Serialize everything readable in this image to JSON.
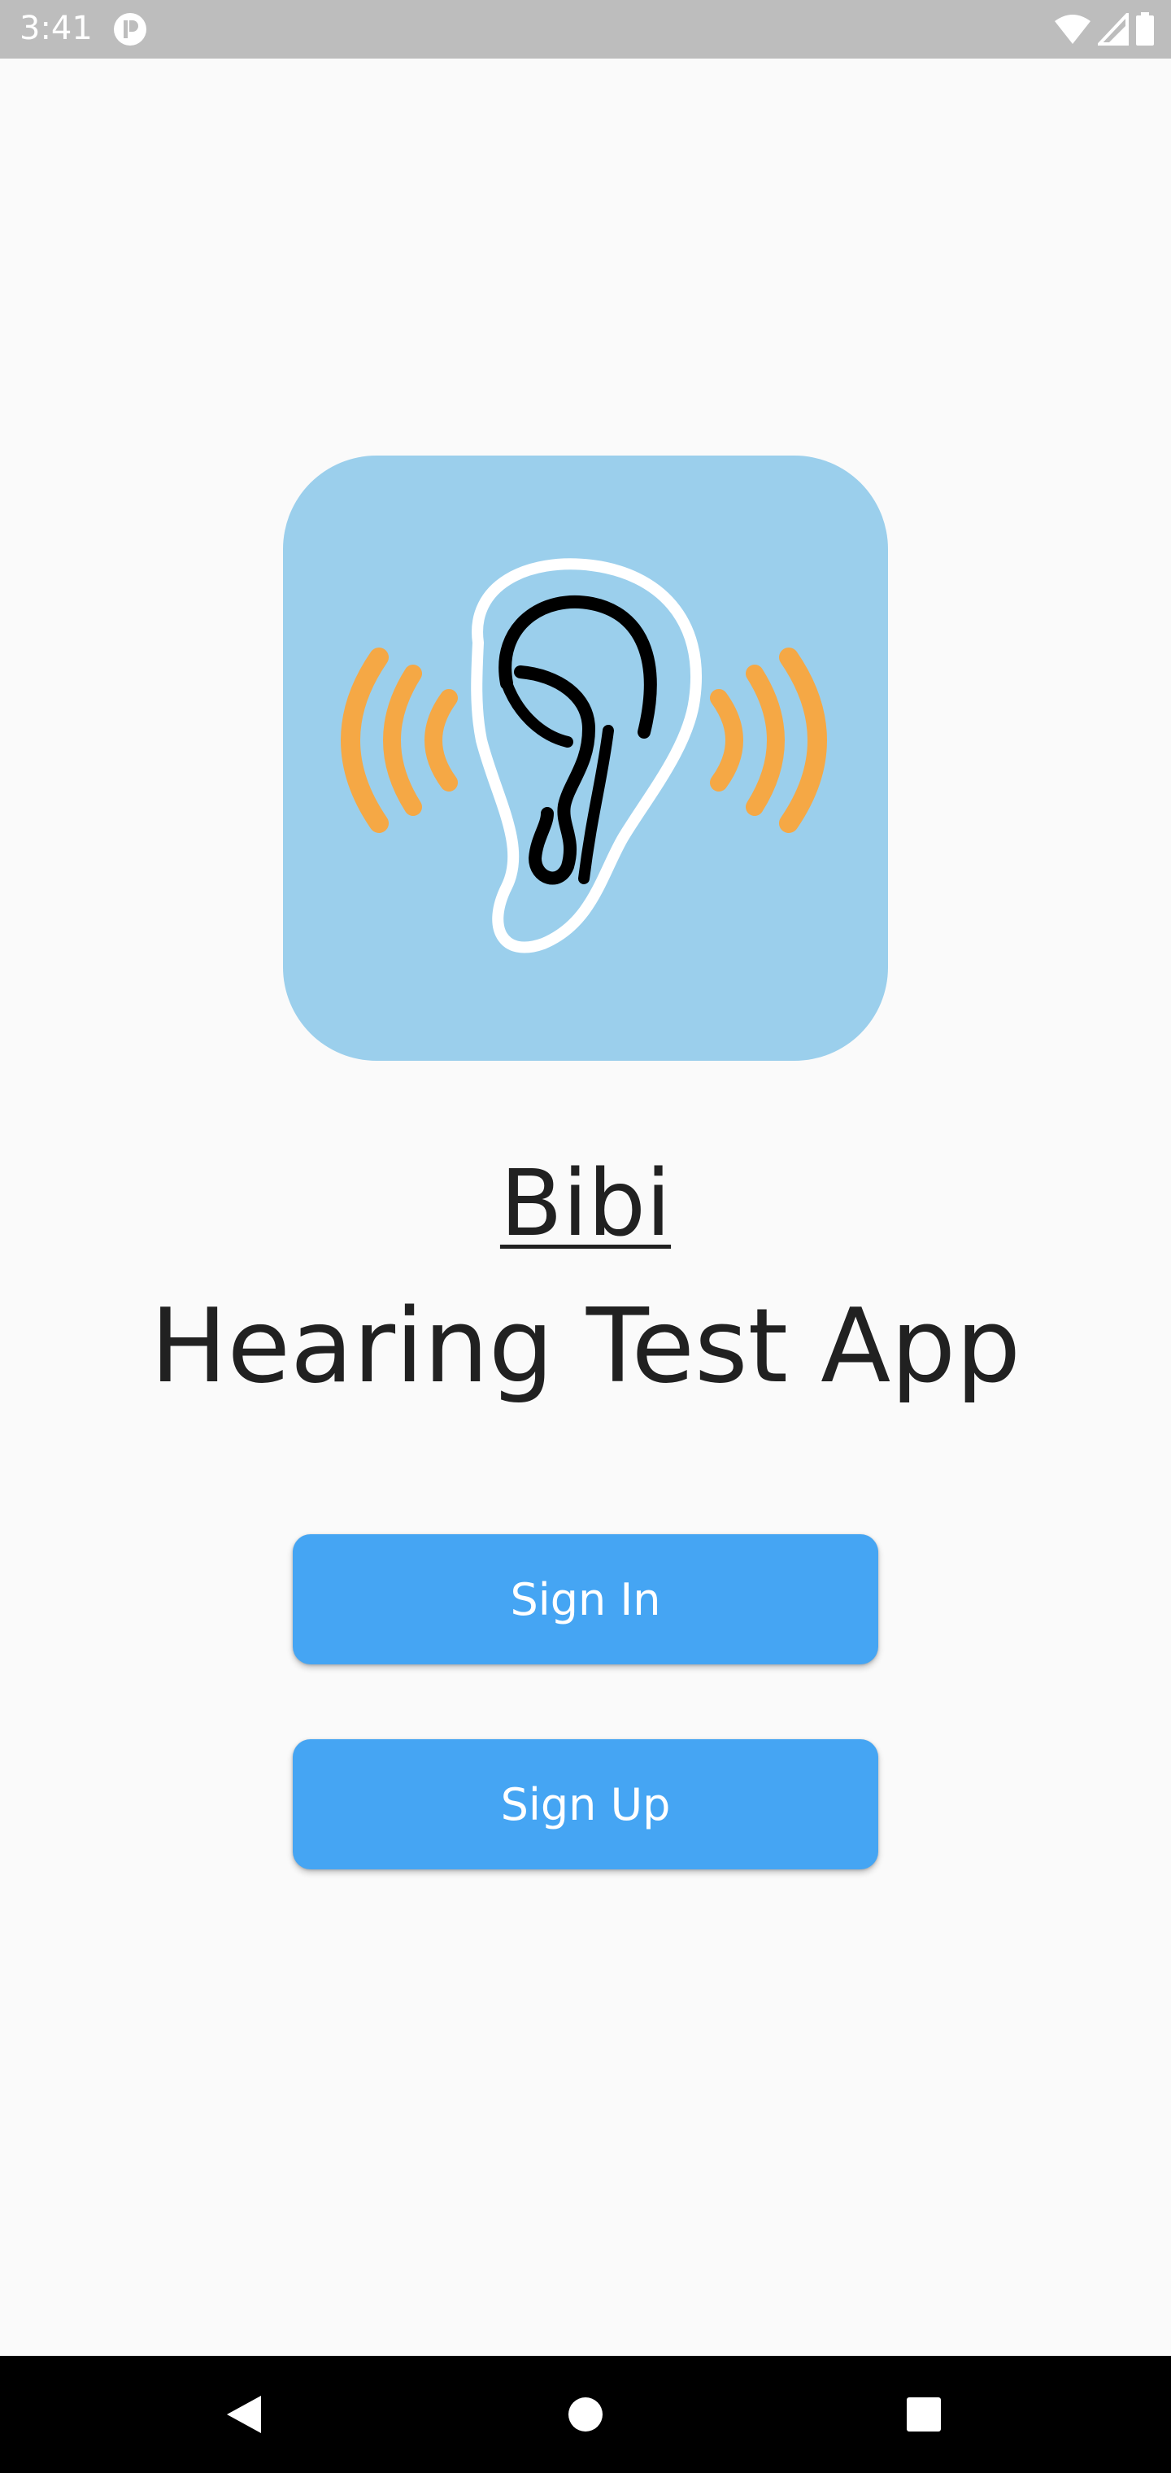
{
  "status_bar": {
    "time": "3:41",
    "icons": [
      "notification-app-icon",
      "wifi-icon",
      "signal-icon",
      "battery-icon"
    ]
  },
  "logo": {
    "icon": "ear-sound-waves-icon",
    "colors": {
      "background": "#9bcfec",
      "waves": "#f5a845",
      "ear_outline": "#ffffff",
      "ear_inner": "#000000"
    }
  },
  "title": {
    "app_name": "Bibi",
    "subtitle": "Hearing Test App"
  },
  "buttons": {
    "sign_in": "Sign In",
    "sign_up": "Sign Up"
  },
  "navigation": {
    "icons": [
      "back-icon",
      "home-icon",
      "recents-icon"
    ]
  },
  "colors": {
    "button": "#45a5f3",
    "background": "#fafafa",
    "status_bar": "#bdbdbd",
    "nav_bar": "#000000"
  }
}
